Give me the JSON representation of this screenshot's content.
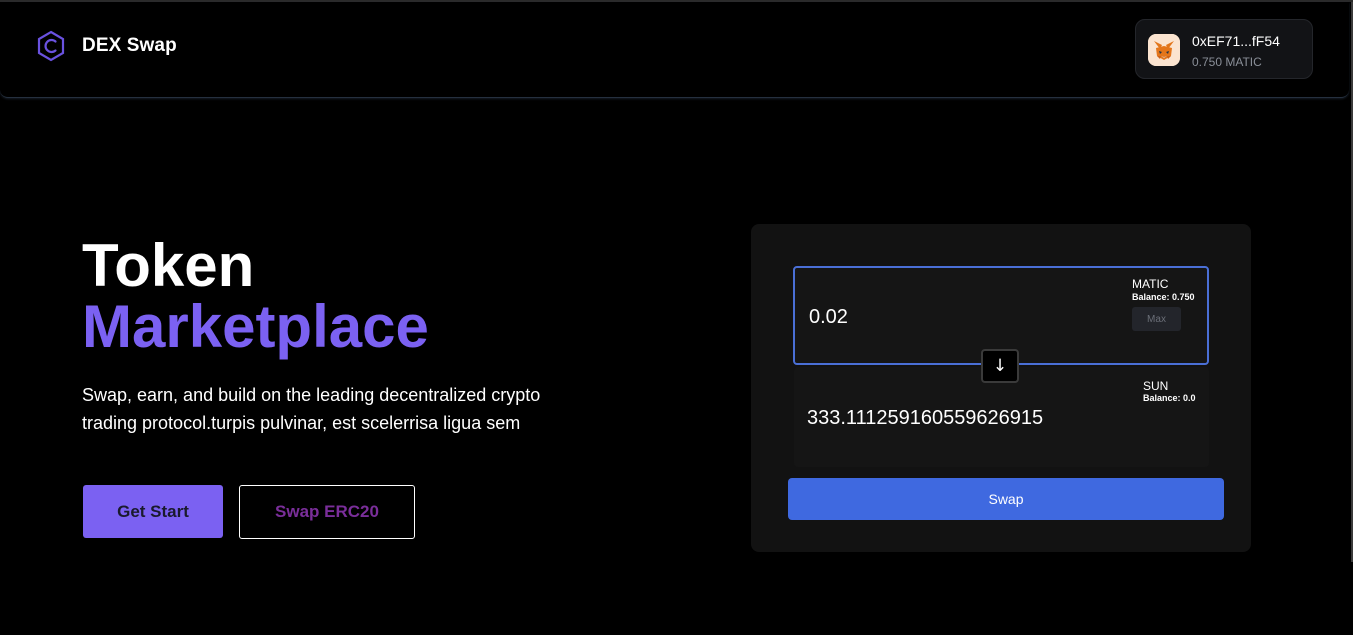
{
  "header": {
    "brand_name": "DEX Swap",
    "brand_icon": "hexagon-c-logo",
    "wallet": {
      "address": "0xEF71...fF54",
      "balance": "0.750 MATIC",
      "avatar_icon": "metamask-fox-icon"
    }
  },
  "hero": {
    "title_line1": "Token",
    "title_line2": "Marketplace",
    "description": "Swap, earn, and build on the leading decentralized crypto trading protocol.turpis pulvinar, est scelerrisa ligua sem",
    "primary_button": "Get Start",
    "secondary_button": "Swap ERC20"
  },
  "swap": {
    "from": {
      "amount": "0.02",
      "token": "MATIC",
      "balance": "Balance: 0.750",
      "max_label": "Max"
    },
    "flip_icon": "arrow-down-icon",
    "flip_label": "↓",
    "to": {
      "amount": "333.111259160559626915",
      "token": "SUN",
      "balance": "Balance: 0.0"
    },
    "swap_button": "Swap"
  },
  "colors": {
    "accent_purple": "#7b61f2",
    "swap_blue": "#3f69e0",
    "background": "#000000",
    "card": "#121212"
  }
}
